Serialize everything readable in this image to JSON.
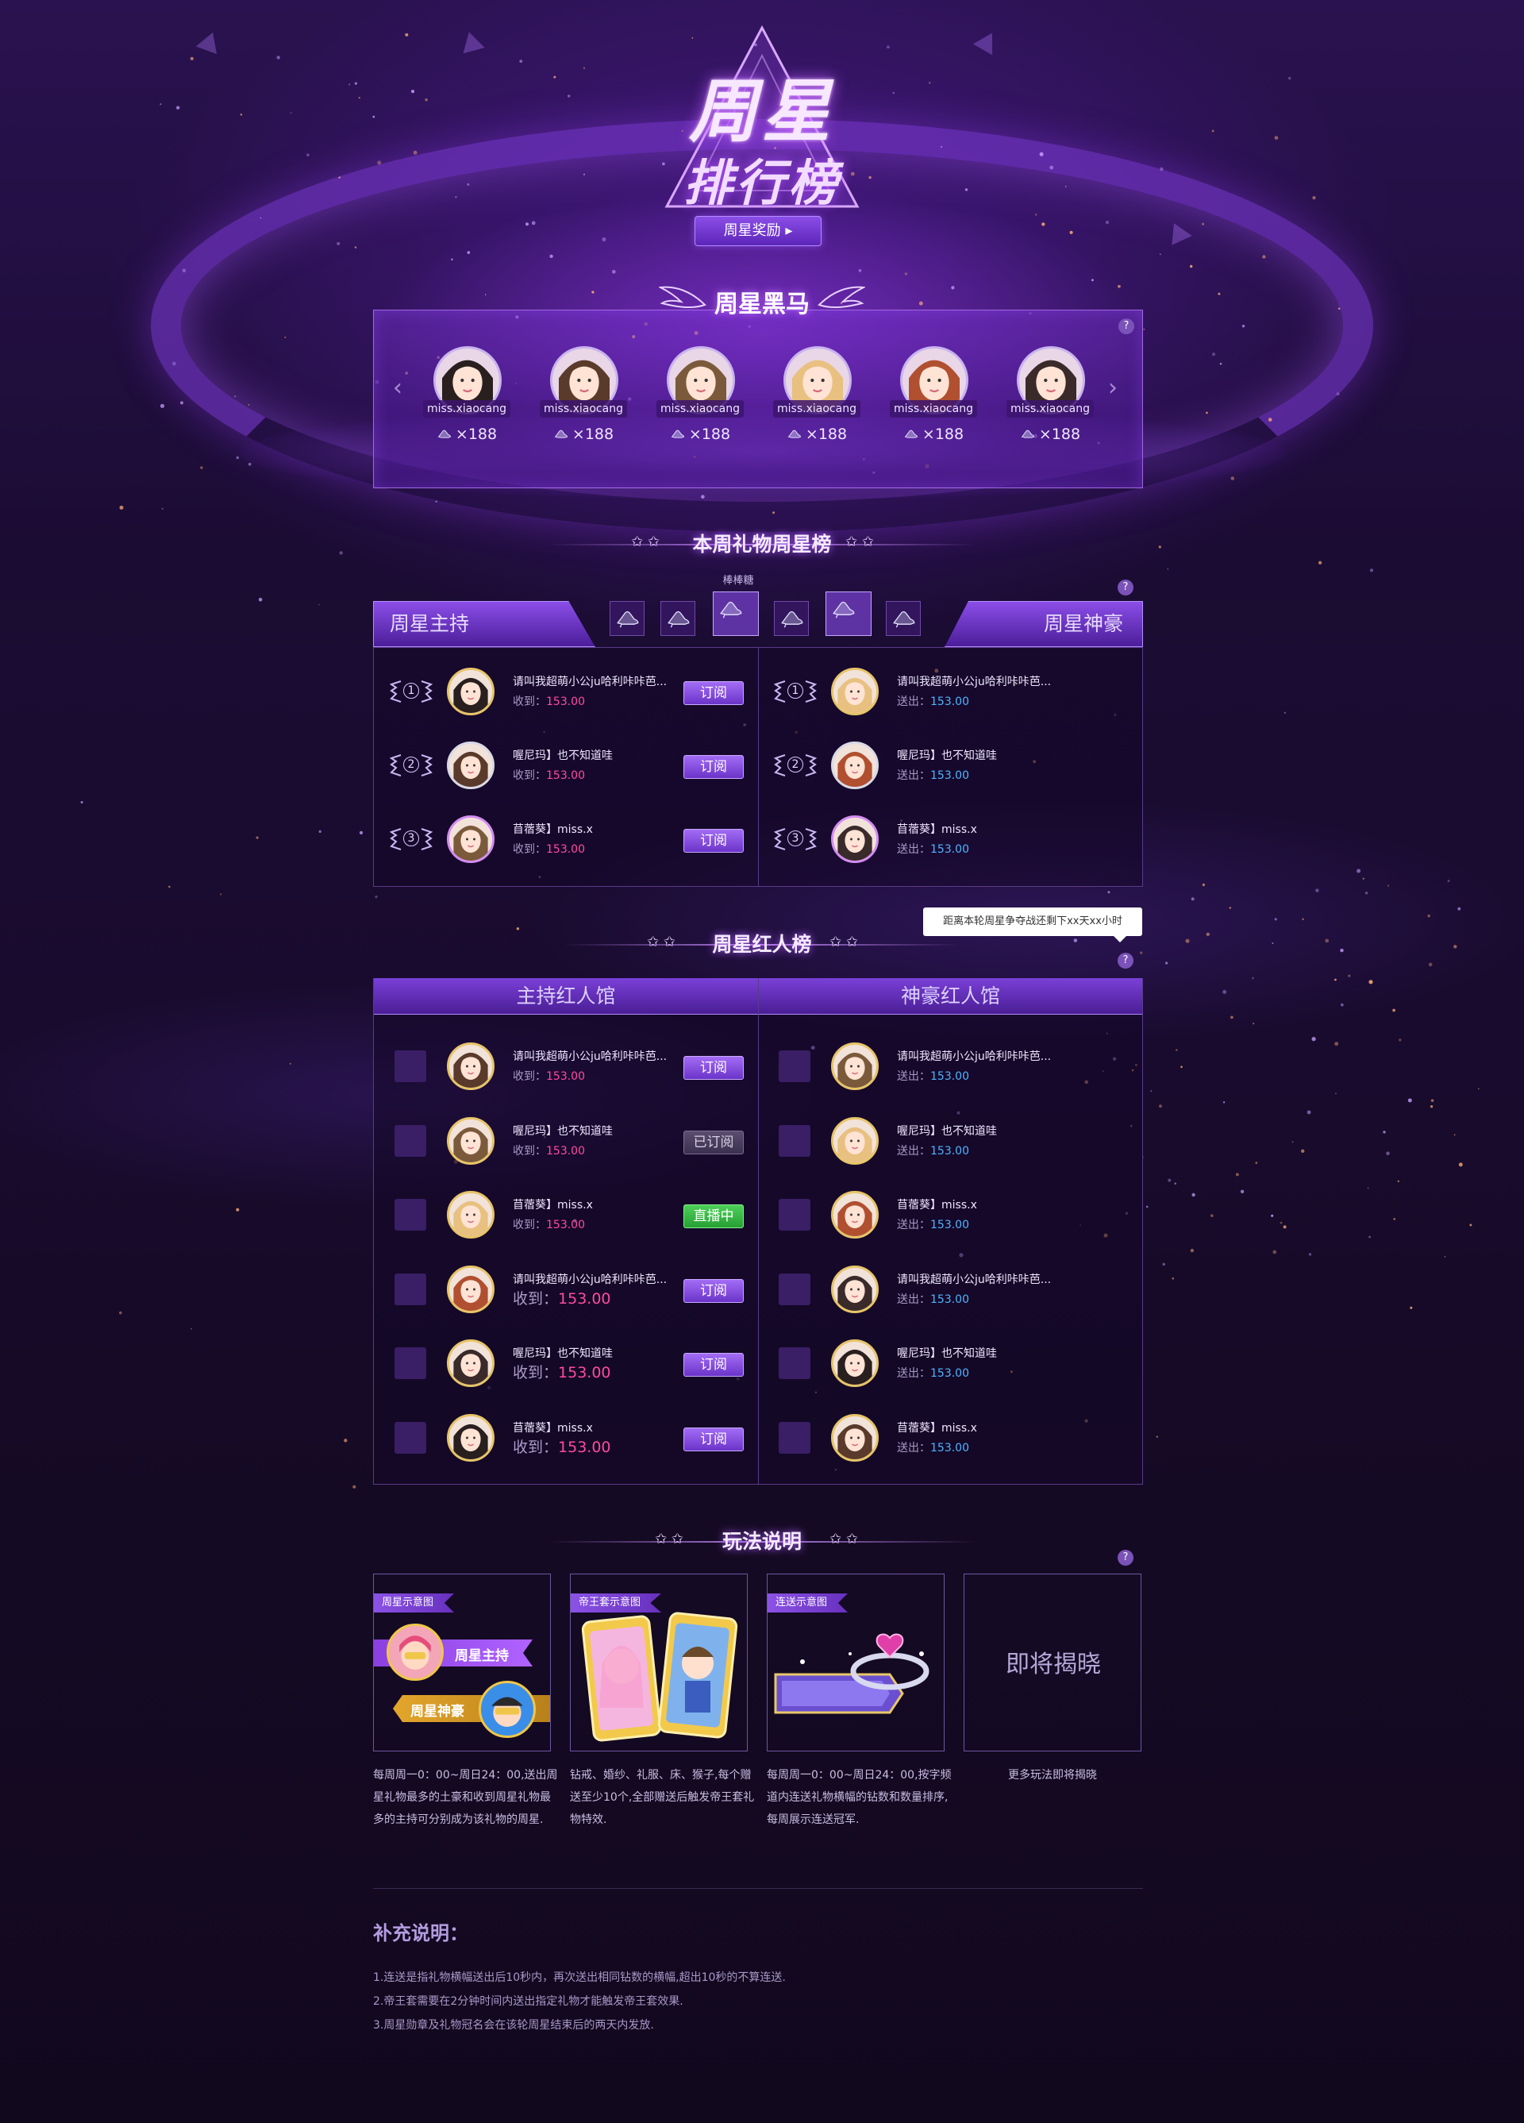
{
  "header": {
    "logo_line1": "周星",
    "logo_line2": "排行榜",
    "reward_button": "周星奖励"
  },
  "dark_horse": {
    "title": "周星黑马",
    "items": [
      {
        "name": "miss.xiaocang",
        "count": "×188"
      },
      {
        "name": "miss.xiaocang",
        "count": "×188"
      },
      {
        "name": "miss.xiaocang",
        "count": "×188"
      },
      {
        "name": "miss.xiaocang",
        "count": "×188"
      },
      {
        "name": "miss.xiaocang",
        "count": "×188"
      },
      {
        "name": "miss.xiaocang",
        "count": "×188"
      }
    ]
  },
  "gift_rank": {
    "title": "本周礼物周星榜",
    "selected_gift": "棒棒糖",
    "tab_host": "周星主持",
    "tab_rich": "周星神豪",
    "hosts": [
      {
        "rank": "1",
        "name": "请叫我超萌小公ju哈利咔咔芭...",
        "label": "收到：",
        "value": "153.00",
        "button": "订阅"
      },
      {
        "rank": "2",
        "name": "喔尼玛】也不知道哇",
        "label": "收到：",
        "value": "153.00",
        "button": "订阅"
      },
      {
        "rank": "3",
        "name": "苜蓿葵】miss.x",
        "label": "收到：",
        "value": "153.00",
        "button": "订阅"
      }
    ],
    "riches": [
      {
        "rank": "1",
        "name": "请叫我超萌小公ju哈利咔咔芭...",
        "label": "送出：",
        "value": "153.00"
      },
      {
        "rank": "2",
        "name": "喔尼玛】也不知道哇",
        "label": "送出：",
        "value": "153.00"
      },
      {
        "rank": "3",
        "name": "苜蓿葵】miss.x",
        "label": "送出：",
        "value": "153.00"
      }
    ]
  },
  "red_list": {
    "title": "周星红人榜",
    "tooltip": "距离本轮周星争夺战还剩下xx天xx小时",
    "host_hall": "主持红人馆",
    "rich_hall": "神豪红人馆",
    "hosts": [
      {
        "name": "请叫我超萌小公ju哈利咔咔芭...",
        "label": "收到：",
        "value": "153.00",
        "button": "订阅"
      },
      {
        "name": "喔尼玛】也不知道哇",
        "label": "收到：",
        "value": "153.00",
        "button": "已订阅"
      },
      {
        "name": "苜蓿葵】miss.x",
        "label": "收到：",
        "value": "153.00",
        "button": "直播中"
      },
      {
        "name": "请叫我超萌小公ju哈利咔咔芭...",
        "label": "收到：",
        "value": "153.00",
        "button": "订阅"
      },
      {
        "name": "喔尼玛】也不知道哇",
        "label": "收到：",
        "value": "153.00",
        "button": "订阅"
      },
      {
        "name": "苜蓿葵】miss.x",
        "label": "收到：",
        "value": "153.00",
        "button": "订阅"
      }
    ],
    "riches": [
      {
        "name": "请叫我超萌小公ju哈利咔咔芭...",
        "label": "送出：",
        "value": "153.00"
      },
      {
        "name": "喔尼玛】也不知道哇",
        "label": "送出：",
        "value": "153.00"
      },
      {
        "name": "苜蓿葵】miss.x",
        "label": "送出：",
        "value": "153.00"
      },
      {
        "name": "请叫我超萌小公ju哈利咔咔芭...",
        "label": "送出：",
        "value": "153.00"
      },
      {
        "name": "喔尼玛】也不知道哇",
        "label": "送出：",
        "value": "153.00"
      },
      {
        "name": "苜蓿葵】miss.x",
        "label": "送出：",
        "value": "153.00"
      }
    ]
  },
  "gameplay": {
    "title": "玩法说明",
    "cards": [
      {
        "tag": "周星示意图",
        "badge_host": "周星主持",
        "badge_rich": "周星神豪",
        "desc": "每周周一0：00~周日24：00,送出周星礼物最多的土豪和收到周星礼物最多的主持可分别成为该礼物的周星."
      },
      {
        "tag": "帝王套示意图",
        "desc": "钻戒、婚纱、礼服、床、猴子,每个赠送至少10个,全部赠送后触发帝王套礼物特效."
      },
      {
        "tag": "连送示意图",
        "desc": "每周周一0：00~周日24：00,按字频道内连送礼物横幅的钻数和数量排序,每周展示连送冠军."
      },
      {
        "soon": "即将揭晓",
        "desc": "更多玩法即将揭晓"
      }
    ]
  },
  "supplement": {
    "title": "补充说明：",
    "items": [
      "1.连送是指礼物横幅送出后10秒内，再次送出相同钻数的横幅,超出10秒的不算连送.",
      "2.帝王套需要在2分钟时间内送出指定礼物才能触发帝王套效果.",
      "3.周星勋章及礼物冠名会在该轮周星结束后的两天内发放."
    ]
  },
  "colors": {
    "accent": "#8b4ee8",
    "receive_value": "#ff4aa0",
    "send_value": "#4fb4ff",
    "live": "#3cc048"
  }
}
